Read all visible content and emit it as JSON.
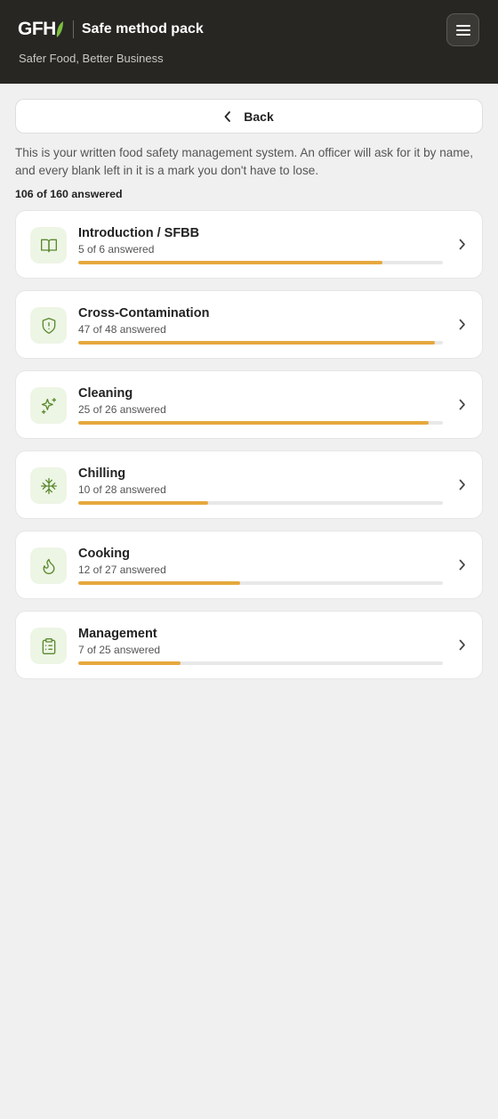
{
  "header": {
    "logo_text": "GFH",
    "title": "Safe method pack",
    "tagline": "Safer Food, Better Business"
  },
  "back": {
    "label": "Back"
  },
  "intro": "This is your written food safety management system. An officer will ask for it by name, and every blank left in it is a mark you don't have to lose.",
  "summary": "106 of 160 answered",
  "colors": {
    "header_bg": "#272623",
    "accent": "#e6a83d",
    "icon_green": "#5a8a2e",
    "icon_bg": "#edf5e5"
  },
  "sections": [
    {
      "title": "Introduction / SFBB",
      "answered": "5 of 6 answered",
      "progress": 0.833,
      "icon": "book-icon"
    },
    {
      "title": "Cross-Contamination",
      "answered": "47 of 48 answered",
      "progress": 0.979,
      "icon": "shield-alert-icon"
    },
    {
      "title": "Cleaning",
      "answered": "25 of 26 answered",
      "progress": 0.962,
      "icon": "sparkles-icon"
    },
    {
      "title": "Chilling",
      "answered": "10 of 28 answered",
      "progress": 0.357,
      "icon": "snowflake-icon"
    },
    {
      "title": "Cooking",
      "answered": "12 of 27 answered",
      "progress": 0.444,
      "icon": "flame-icon"
    },
    {
      "title": "Management",
      "answered": "7 of 25 answered",
      "progress": 0.28,
      "icon": "clipboard-icon"
    }
  ]
}
